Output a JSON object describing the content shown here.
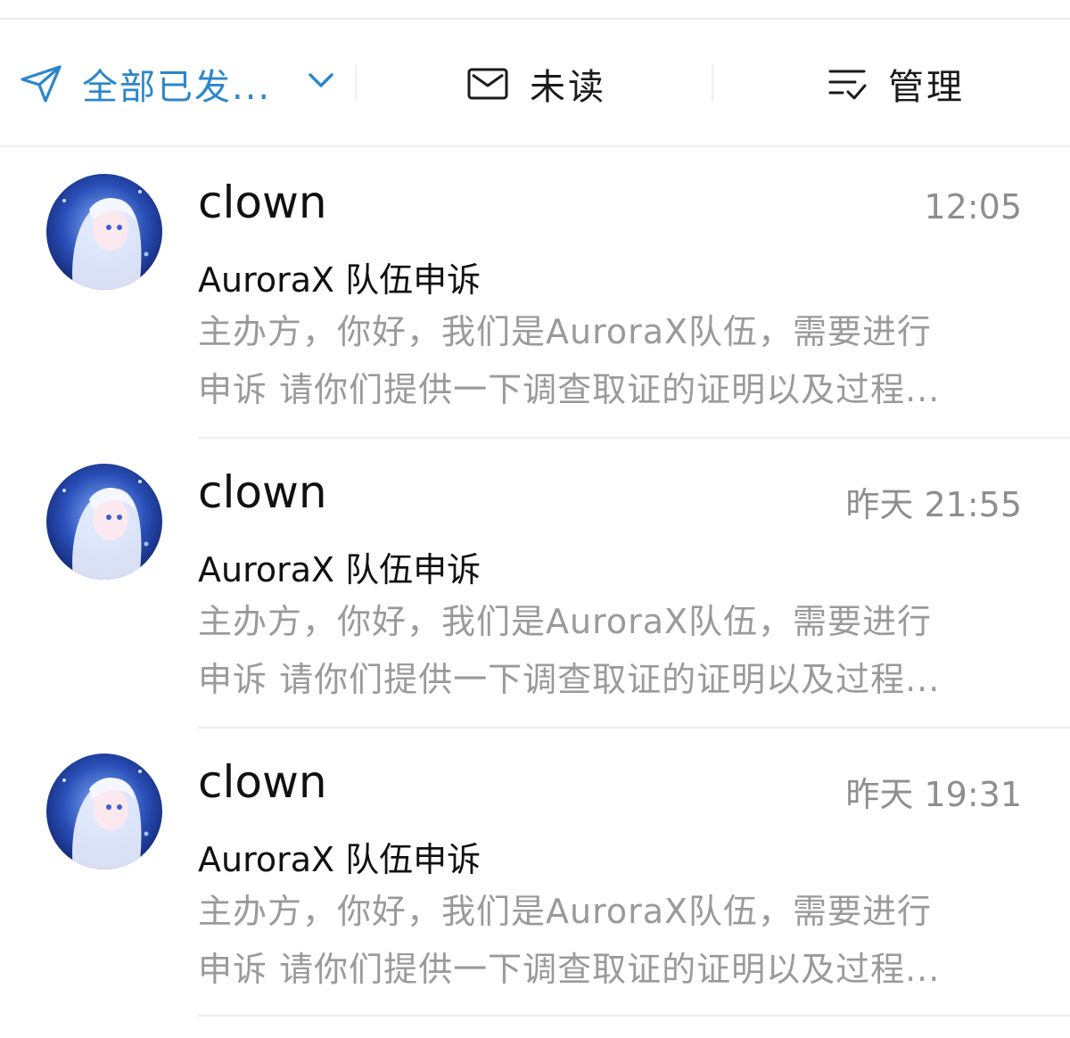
{
  "toolbar": {
    "folder_label": "全部已发...",
    "unread_label": "未读",
    "manage_label": "管理",
    "icons": {
      "folder": "send-icon",
      "folder_dropdown": "chevron-down-icon",
      "unread": "mail-icon",
      "manage": "manage-list-icon"
    },
    "accent_color": "#2b86cc"
  },
  "mails": [
    {
      "sender": "clown",
      "time": "12:05",
      "subject": "AuroraX 队伍申诉",
      "preview_line1": "主办方，你好，我们是AuroraX队伍，需要进行",
      "preview_line2": "申诉  请你们提供一下调查取证的证明以及过程..."
    },
    {
      "sender": "clown",
      "time": "昨天 21:55",
      "subject": "AuroraX 队伍申诉",
      "preview_line1": "主办方，你好，我们是AuroraX队伍，需要进行",
      "preview_line2": "申诉  请你们提供一下调查取证的证明以及过程..."
    },
    {
      "sender": "clown",
      "time": "昨天 19:31",
      "subject": "AuroraX 队伍申诉",
      "preview_line1": "主办方，你好，我们是AuroraX队伍，需要进行",
      "preview_line2": "申诉  请你们提供一下调查取证的证明以及过程..."
    }
  ]
}
